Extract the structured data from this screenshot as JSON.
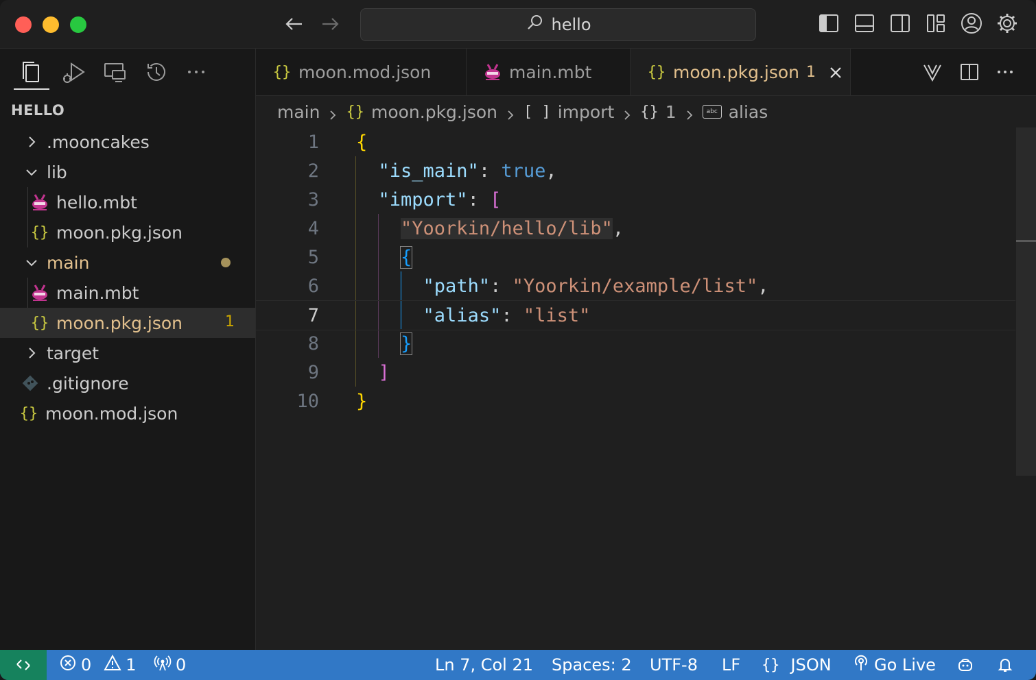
{
  "titlebar": {
    "search_text": "hello"
  },
  "sidebar": {
    "title": "HELLO",
    "tree": [
      {
        "label": ".mooncakes",
        "type": "folder",
        "expanded": false
      },
      {
        "label": "lib",
        "type": "folder",
        "expanded": true
      },
      {
        "label": "hello.mbt",
        "type": "mbt"
      },
      {
        "label": "moon.pkg.json",
        "type": "json"
      },
      {
        "label": "main",
        "type": "folder",
        "expanded": true
      },
      {
        "label": "main.mbt",
        "type": "mbt"
      },
      {
        "label": "moon.pkg.json",
        "type": "json",
        "problems": "1"
      },
      {
        "label": "target",
        "type": "folder",
        "expanded": false
      },
      {
        "label": ".gitignore",
        "type": "git"
      },
      {
        "label": "moon.mod.json",
        "type": "json"
      }
    ]
  },
  "tabs": [
    {
      "label": "moon.mod.json",
      "type": "json",
      "active": false
    },
    {
      "label": "main.mbt",
      "type": "mbt",
      "active": false
    },
    {
      "label": "moon.pkg.json",
      "type": "json",
      "active": true,
      "problems": "1"
    }
  ],
  "icons": {
    "json_glyph": "{}",
    "abc_glyph": "abc",
    "array_glyph": "[ ]"
  },
  "breadcrumbs": [
    "main",
    "moon.pkg.json",
    "import",
    "1",
    "alias"
  ],
  "editor": {
    "line_numbers": [
      "1",
      "2",
      "3",
      "4",
      "5",
      "6",
      "7",
      "8",
      "9",
      "10"
    ],
    "current_line": 7
  },
  "status": {
    "errors": "0",
    "warnings": "1",
    "ports": "0",
    "cursor": "Ln 7, Col 21",
    "spaces": "Spaces: 2",
    "encoding": "UTF-8",
    "eol": "LF",
    "language": "JSON",
    "golive": "Go Live"
  },
  "colors": {
    "statusbar": "#3178c6",
    "remote": "#16825d",
    "json_icon": "#cbcb41",
    "modified_text": "#e2c08d"
  }
}
